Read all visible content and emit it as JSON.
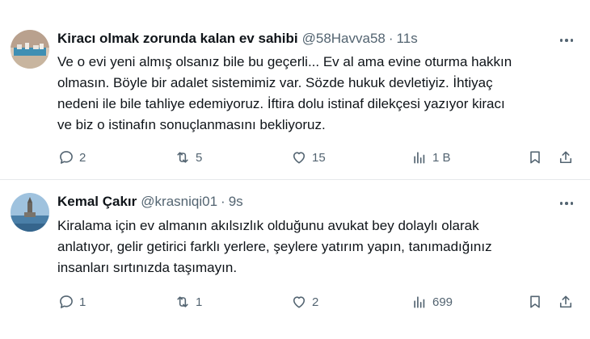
{
  "tweets": [
    {
      "display_name": "Kiracı olmak zorunda kalan ev sahibi",
      "handle": "@58Havva58",
      "separator": "·",
      "time": "11s",
      "lines": [
        "Ve o evi yeni almış olsanız bile bu geçerli... Ev al ama evine oturma hakkın",
        "olmasın. Böyle bir adalet sistemimiz var. Sözde hukuk devletiyiz. İhtiyaç",
        "nedeni ile bile tahliye edemiyoruz. İftira dolu istinaf dilekçesi yazıyor kiracı",
        "ve biz o istinafın sonuçlanmasını bekliyoruz."
      ],
      "replies": "2",
      "retweets": "5",
      "likes": "15",
      "views": "1 B"
    },
    {
      "display_name": "Kemal Çakır",
      "handle": "@krasniqi01",
      "separator": "·",
      "time": "9s",
      "lines": [
        "Kiralama için ev almanın akılsızlık olduğunu avukat bey dolaylı olarak",
        "anlatıyor, gelir getirici farklı yerlere, şeylere yatırım yapın, tanımadığınız",
        "insanları sırtınızda taşımayın."
      ],
      "replies": "1",
      "retweets": "1",
      "likes": "2",
      "views": "699"
    }
  ],
  "icons": {
    "reply": "reply-icon",
    "retweet": "retweet-icon",
    "like": "heart-icon",
    "views": "views-icon",
    "bookmark": "bookmark-icon",
    "share": "share-icon",
    "more": "more-icon"
  },
  "colors": {
    "text_primary": "#0f1419",
    "text_secondary": "#536471",
    "divider": "#e6e9eb"
  }
}
